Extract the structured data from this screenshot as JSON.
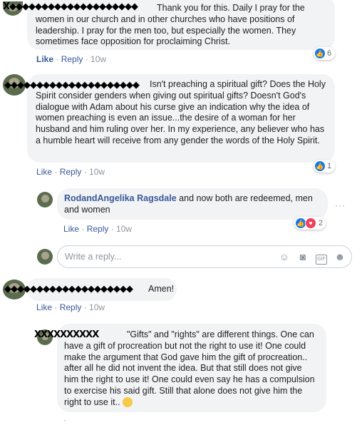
{
  "comments": [
    {
      "text": "Thank you for this. Daily I pray for the women in our church and in other churches who have positions of leadership. I pray for the men too, but especially the women. They sometimes face opposition for proclaiming Christ.",
      "like": "Like",
      "reply": "Reply",
      "time": "10w",
      "reaction_count": "6"
    },
    {
      "text": "Isn't preaching a spiritual gift? Does the Holy Spirit consider genders when giving out spiritual gifts? Doesn't God's dialogue with Adam about his curse give an indication why the idea of women preaching is even an issue...the desire of a woman for her husband and him ruling over her. In my experience, any believer who has a humble heart will receive from any gender the words of the Holy Spirit.",
      "like": "Like",
      "reply": "Reply",
      "time": "10w",
      "reaction_count": "1"
    },
    {
      "author": "RodandAngelika Ragsdale",
      "text": "and now both are redeemed, men and women",
      "like": "Like",
      "reply": "Reply",
      "time": "10w",
      "reaction_count": "2"
    },
    {
      "text": "Amen!",
      "like": "Like",
      "reply": "Reply",
      "time": "10w"
    },
    {
      "text": "\"Gifts\" and \"rights\" are different things. One can have a gift of procreation but not the right to use it! One could make the argument that God gave him the gift of procreation.. after all he did not invent the idea. But that still does not give him the right to use it! One could even say he has a compulsion to exercise his said gift. Still that alone does not give him the right to use it.."
    }
  ],
  "reply_box": {
    "placeholder": "Write a reply..."
  },
  "icons": [
    "emoji-icon",
    "camera-icon",
    "gif-icon",
    "sticker-icon",
    "more-icon"
  ]
}
